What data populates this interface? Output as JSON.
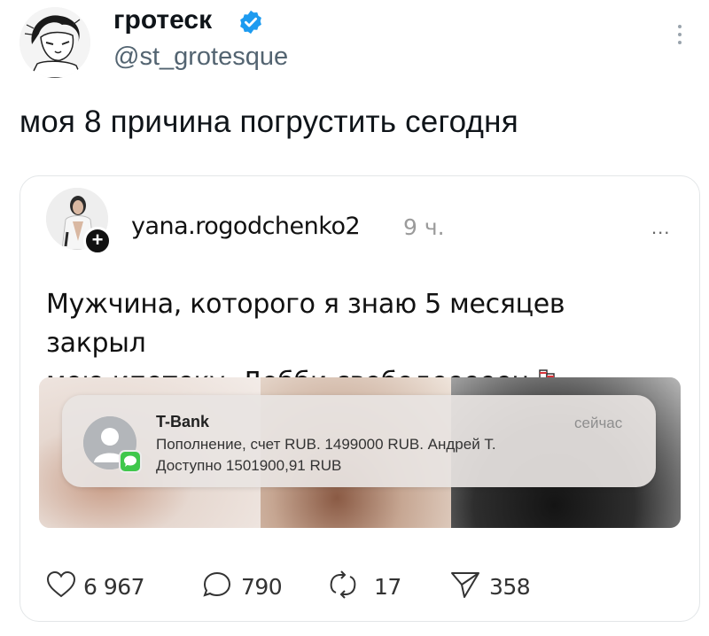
{
  "tweet": {
    "author_name": "гротеск",
    "author_handle": "@st_grotesque",
    "text": "моя 8 причина погрустить сегодня",
    "icons": {
      "verified": "verified-badge-icon",
      "more": "more-vertical-icon"
    },
    "colors": {
      "verified": "#1d9bf0",
      "handle": "#536471"
    }
  },
  "quoted_post": {
    "username": "yana.rogodchenko2",
    "time": "9 ч.",
    "more": "...",
    "text_line1": "Мужчина, которого я знаю 5 месяцев закрыл",
    "text_line2": "мою ипотеку. Добби свободееееен",
    "emoji": "socks-emoji",
    "notification": {
      "title": "T-Bank",
      "time": "сейчас",
      "line1": "Пополнение, счет RUB. 1499000 RUB. Андрей Т.",
      "line2": "Доступно 1501900,91 RUB",
      "badge_color": "#3fc74b"
    },
    "stats": {
      "likes": "6 967",
      "comments": "790",
      "reposts": "17",
      "shares": "358"
    }
  }
}
